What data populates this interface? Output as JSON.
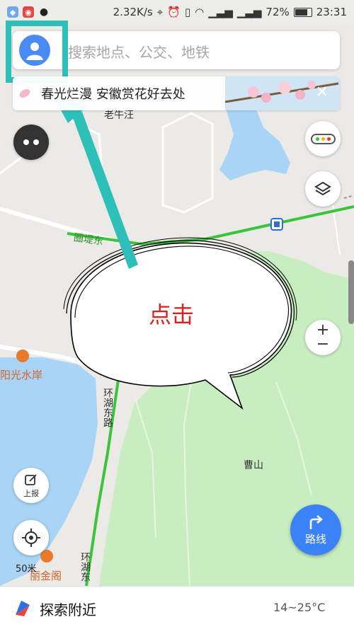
{
  "status_bar": {
    "speed": "2.32K/s",
    "battery": "72%",
    "time": "23:31"
  },
  "search": {
    "placeholder": "搜索地点、公交、地铁"
  },
  "banner": {
    "text": "春光烂漫 安徽赏花好去处",
    "close_icon": "close-icon"
  },
  "map_labels": {
    "laoniuwang": "老牛汪",
    "weidi": "圈堤东",
    "yangguang": "阳光水岸",
    "huanhu1": "环湖东路",
    "caoshan": "曹山",
    "lijinge": "丽金阁",
    "huanhu2": "环湖东"
  },
  "annotation": {
    "callout_text": "点击"
  },
  "controls": {
    "report_label": "上报",
    "route_label": "路线",
    "zoom_in": "+",
    "zoom_out": "−",
    "scale": "50米"
  },
  "bottom_bar": {
    "explore_label": "探索附近",
    "weather": "14~25°C"
  },
  "colors": {
    "accent_blue": "#3b82f6",
    "highlight_teal": "#2ebfb8",
    "callout_red": "#e0201f",
    "park_green": "#c8edc0",
    "water_blue": "#a9d4f5"
  }
}
